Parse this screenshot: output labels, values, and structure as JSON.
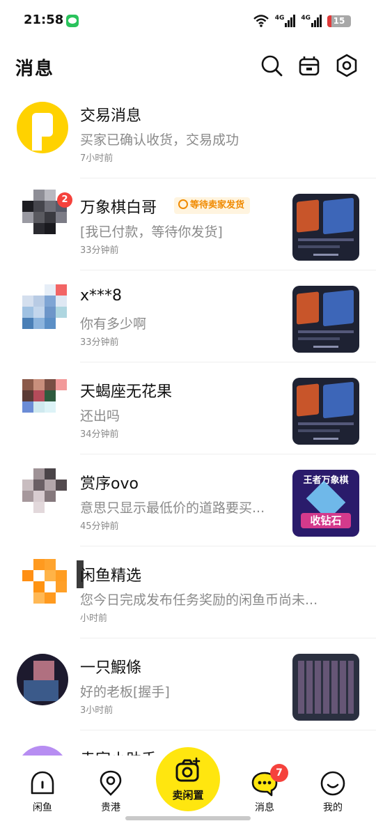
{
  "status_bar": {
    "time": "21:58",
    "network": "4G",
    "battery": "15",
    "icons": [
      "wechat-icon",
      "wifi-icon",
      "signal-icon",
      "battery-icon"
    ]
  },
  "header": {
    "title": "消息",
    "icons": [
      "search-icon",
      "store-icon",
      "settings-icon"
    ]
  },
  "messages": [
    {
      "name": "交易消息",
      "preview": "买家已确认收货，交易成功",
      "time": "7小时前"
    },
    {
      "name": "万象棋白哥",
      "preview": "[我已付款，等待你发货]",
      "time": "33分钟前",
      "badge": "2",
      "tag": "等待卖家发货"
    },
    {
      "name": "x***8",
      "preview": "你有多少啊",
      "time": "33分钟前"
    },
    {
      "name": "天蝎座无花果",
      "preview": "还出吗",
      "time": "34分钟前"
    },
    {
      "name": "赏序ovo",
      "preview": "意思只显示最低价的道路要买...",
      "time": "45分钟前",
      "thumb_text": [
        "王者万象棋",
        "收钻石"
      ]
    },
    {
      "name": "闲鱼精选",
      "preview": "您今日完成发布任务奖励的闲鱼币尚未...",
      "time": "小时前"
    },
    {
      "name": "一只鰕條",
      "preview": "好的老板[握手]",
      "time": "3小时前"
    },
    {
      "name": "卖家小助手"
    }
  ],
  "bottom_nav": {
    "items": [
      {
        "label": "闲鱼",
        "icon": "home-icon"
      },
      {
        "label": "贵港",
        "icon": "location-icon"
      },
      {
        "label": "卖闲置",
        "icon": "camera-icon"
      },
      {
        "label": "消息",
        "icon": "message-icon",
        "badge": "7"
      },
      {
        "label": "我的",
        "icon": "profile-icon"
      }
    ]
  },
  "colors": {
    "brand_yellow": "#ffe60f",
    "badge_red": "#f5423c",
    "tag_orange": "#f08a00",
    "secondary_text": "#8a8a8a"
  }
}
